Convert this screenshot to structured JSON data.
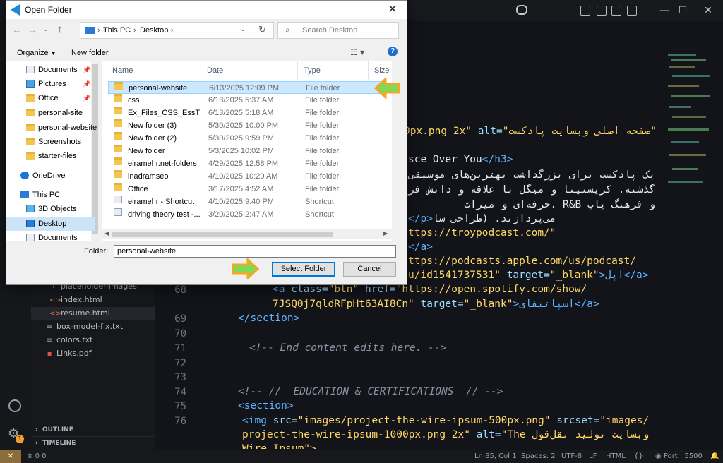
{
  "editor": {
    "lines": [
      {
        "num": "",
        "t1": "0px.png 2x\" ",
        "t2": "alt=",
        "t3": "\"صفحه اصلی وبسایت پادکست\""
      },
      {
        "num": "",
        "t1": "sce Over You",
        "t2": "</h3>"
      },
      {
        "num": "",
        "t1": "یک پادکست برای بزرگداشت بهترین‌های موسیقی"
      },
      {
        "num": "",
        "t1": "گذشته. کریستینا و میگل با علاقه و دانش فر"
      },
      {
        "num": "",
        "t1": "و فرهنگ پاپ R&B .حرفه‌ای و میراث"
      },
      {
        "num": "",
        "t1": "می‌پردازند. (طراحی سا",
        "t2": "</p>"
      },
      {
        "num": "",
        "t1": "ttps://troypodcast.com/\""
      },
      {
        "num": "",
        "t1": "</a>"
      },
      {
        "num": "",
        "t1": "ttps://podcasts.apple.com/us/podcast/"
      },
      {
        "num": "",
        "t1": "u/id1541737531\" ",
        "t2": "target=",
        "t3": "\"_blank\"",
        "t4": ">اپل</a>"
      },
      {
        "num": "68",
        "t1": "<a ",
        "t2": "class=",
        "t3": "\"btn\" ",
        "t4": "href=",
        "t5": "\"https://open.spotify.com/show/"
      },
      {
        "num": "",
        "t1": "7JSQ0j7qldRFpHt63AI8Cn\" ",
        "t2": "target=",
        "t3": "\"_blank\"",
        "t4": ">اسپاتیفای</a>"
      },
      {
        "num": "69",
        "t1": "</section>"
      },
      {
        "num": "70",
        "t1": ""
      },
      {
        "num": "71",
        "t1": "<!-- End content edits here. -->"
      },
      {
        "num": "72",
        "t1": ""
      },
      {
        "num": "73",
        "t1": ""
      },
      {
        "num": "74",
        "t1": "<!-- //  EDUCATION & CERTIFICATIONS  // -->"
      },
      {
        "num": "75",
        "t1": "<section>"
      },
      {
        "num": "76",
        "t1": "<img ",
        "t2": "src=",
        "t3": "\"images/project-the-wire-ipsum-500px.png\" ",
        "t4": "srcset=",
        "t5": "\"images/"
      },
      {
        "num": "",
        "t1": "project-the-wire-ipsum-1000px.png 2x\" ",
        "t2": "alt=",
        "t3": "\"The وبسایت تولید نقل‌قول"
      },
      {
        "num": "",
        "t1": "Wire Ipsum\">"
      }
    ]
  },
  "explorer": {
    "items": [
      {
        "label": "placeholder-images",
        "icon": "chevron-right-icon"
      },
      {
        "label": "index.html",
        "icon": "html-file-icon"
      },
      {
        "label": "resume.html",
        "icon": "html-file-icon"
      },
      {
        "label": "box-model-fix.txt",
        "icon": "text-file-icon"
      },
      {
        "label": "colors.txt",
        "icon": "text-file-icon"
      },
      {
        "label": "Links.pdf",
        "icon": "pdf-file-icon"
      }
    ],
    "outline": "OUTLINE",
    "timeline": "TIMELINE"
  },
  "statusbar": {
    "problems": "0  0",
    "position": "Ln 85, Col 1",
    "spaces": "Spaces: 2",
    "encoding": "UTF-8",
    "eol": "LF",
    "language": "HTML",
    "port": "Port : 5500",
    "badge": "1"
  },
  "dialog": {
    "title": "Open Folder",
    "close": "✕",
    "breadcrumb": [
      "This PC",
      "Desktop"
    ],
    "search_placeholder": "Search Desktop",
    "organize": "Organize",
    "new_folder": "New folder",
    "nav": [
      {
        "label": "Documents",
        "icon": "documents-icon",
        "pin": true
      },
      {
        "label": "Pictures",
        "icon": "pictures-icon",
        "pin": true
      },
      {
        "label": "Office",
        "icon": "folder-icon",
        "pin": true
      },
      {
        "label": "personal-site",
        "icon": "folder-icon",
        "pin": false
      },
      {
        "label": "personal-website",
        "icon": "folder-icon",
        "pin": false
      },
      {
        "label": "Screenshots",
        "icon": "folder-icon",
        "pin": false
      },
      {
        "label": "starter-files",
        "icon": "folder-icon",
        "pin": false
      },
      {
        "label": "OneDrive",
        "icon": "onedrive-icon",
        "pin": false
      },
      {
        "label": "This PC",
        "icon": "computer-icon",
        "pin": false
      },
      {
        "label": "3D Objects",
        "icon": "cube-icon",
        "pin": false
      },
      {
        "label": "Desktop",
        "icon": "desktop-icon",
        "pin": false
      },
      {
        "label": "Documents",
        "icon": "documents-icon",
        "pin": false
      }
    ],
    "columns": {
      "name": "Name",
      "date": "Date",
      "type": "Type",
      "size": "Size"
    },
    "files": [
      {
        "name": "personal-website",
        "date": "6/13/2025 12:09 PM",
        "type": "File folder",
        "size": "",
        "kind": "folder"
      },
      {
        "name": "css",
        "date": "6/13/2025 5:37 AM",
        "type": "File folder",
        "size": "",
        "kind": "folder"
      },
      {
        "name": "Ex_Files_CSS_EssT",
        "date": "6/13/2025 5:18 AM",
        "type": "File folder",
        "size": "",
        "kind": "folder"
      },
      {
        "name": "New folder (3)",
        "date": "5/30/2025 10:00 PM",
        "type": "File folder",
        "size": "",
        "kind": "folder"
      },
      {
        "name": "New folder (2)",
        "date": "5/30/2025 9:59 PM",
        "type": "File folder",
        "size": "",
        "kind": "folder"
      },
      {
        "name": "New folder",
        "date": "5/3/2025 10:02 PM",
        "type": "File folder",
        "size": "",
        "kind": "folder"
      },
      {
        "name": "eiramehr.net-folders",
        "date": "4/29/2025 12:58 PM",
        "type": "File folder",
        "size": "",
        "kind": "folder"
      },
      {
        "name": "inadramseo",
        "date": "4/10/2025 10:20 AM",
        "type": "File folder",
        "size": "",
        "kind": "folder"
      },
      {
        "name": "Office",
        "date": "3/17/2025 4:52 AM",
        "type": "File folder",
        "size": "",
        "kind": "folder"
      },
      {
        "name": "eiramehr - Shortcut",
        "date": "4/10/2025 9:40 PM",
        "type": "Shortcut",
        "size": "1 K",
        "kind": "shortcut"
      },
      {
        "name": "driving theory test -...",
        "date": "3/20/2025 2:47 AM",
        "type": "Shortcut",
        "size": "1 K",
        "kind": "shortcut"
      }
    ],
    "folder_label": "Folder:",
    "folder_value": "personal-website",
    "select_button": "Select Folder",
    "cancel_button": "Cancel",
    "colors": {
      "arrow": "#f6a623",
      "arrow_fill": "#7ed957",
      "accent": "#0078d7"
    }
  }
}
